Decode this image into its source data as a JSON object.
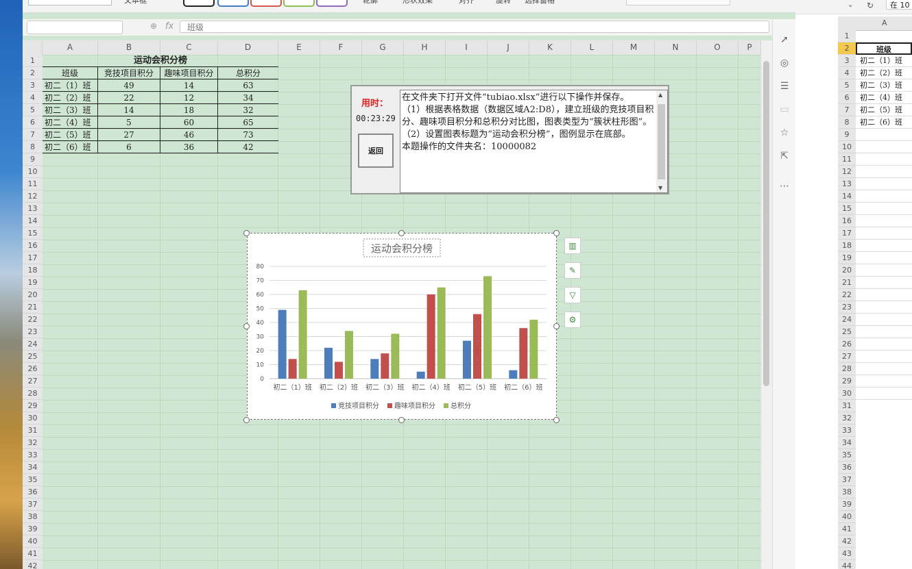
{
  "window": {
    "ribbon": {
      "tool_a": "文本框",
      "tool_b": "轮廓",
      "tool_c": "形状效果",
      "tool_d": "对齐",
      "tool_e": "旋转",
      "tool_f": "选择窗格"
    },
    "formula_bar": {
      "name_box": "",
      "fx_label": "fx",
      "value": "班级"
    },
    "column_headers": [
      "A",
      "B",
      "C",
      "D",
      "E",
      "F",
      "G",
      "H",
      "I",
      "J",
      "K",
      "L",
      "M",
      "N",
      "O",
      "P"
    ],
    "row_count": 42
  },
  "sheet": {
    "title": "运动会积分榜",
    "headers": [
      "班级",
      "竞技项目积分",
      "趣味项目积分",
      "总积分"
    ],
    "rows": [
      [
        "初二（1）班",
        "49",
        "14",
        "63"
      ],
      [
        "初二（2）班",
        "22",
        "12",
        "34"
      ],
      [
        "初二（3）班",
        "14",
        "18",
        "32"
      ],
      [
        "初二（4）班",
        "5",
        "60",
        "65"
      ],
      [
        "初二（5）班",
        "27",
        "46",
        "73"
      ],
      [
        "初二（6）班",
        "6",
        "36",
        "42"
      ]
    ]
  },
  "timer_panel": {
    "label": "用时：",
    "time": "00:23:29",
    "back_button": "返回",
    "instructions": "在文件夹下打开文件“tubiao.xlsx”进行以下操作并保存。\n（1）根据表格数据（数据区域A2:D8），建立班级的竞技项目积分、趣味项目积分和总积分对比图，图表类型为“簇状柱形图”。\n（2）设置图表标题为“运动会积分榜”，图例显示在底部。\n本题操作的文件夹名：10000082"
  },
  "chart_data": {
    "type": "bar",
    "title": "运动会积分榜",
    "categories": [
      "初二（1）班",
      "初二（2）班",
      "初二（3）班",
      "初二（4）班",
      "初二（5）班",
      "初二（6）班"
    ],
    "series": [
      {
        "name": "竞技项目积分",
        "values": [
          49,
          22,
          14,
          5,
          27,
          6
        ],
        "color": "#4e7dbc"
      },
      {
        "name": "趣味项目积分",
        "values": [
          14,
          12,
          18,
          60,
          46,
          36
        ],
        "color": "#c1504c"
      },
      {
        "name": "总积分",
        "values": [
          63,
          34,
          32,
          65,
          73,
          42
        ],
        "color": "#9bbb59"
      }
    ],
    "ylim": [
      0,
      80
    ],
    "yticks": [
      0,
      10,
      20,
      30,
      40,
      50,
      60,
      70,
      80
    ],
    "legend": "bottom",
    "grid": true
  },
  "second_window": {
    "search_value": "在 10",
    "column_header": "A",
    "cells": [
      "",
      "班级",
      "初二（1）班",
      "初二（2）班",
      "初二（3）班",
      "初二（4）班",
      "初二（5）班",
      "初二（6）班"
    ],
    "row_count": 44
  },
  "colors": {
    "sheet_bg": "#cfe6d2",
    "accent_red": "#e02020"
  }
}
